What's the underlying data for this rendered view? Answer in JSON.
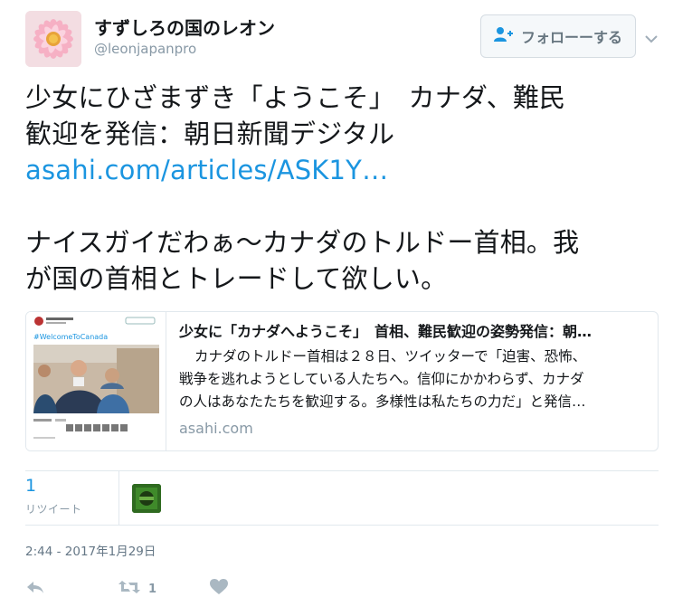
{
  "user": {
    "display_name": "すずしろの国のレオン",
    "handle": "@leonjapanpro"
  },
  "follow_button": {
    "label": "フォローーする"
  },
  "tweet": {
    "lines": [
      "少女にひざまずき「ようこそ」　カナダ、難民",
      "歓迎を発信：朝日新聞デジタル"
    ],
    "link": "asahi.com/articles/ASK1Y…",
    "comment_lines": [
      "ナイスガイだわぁ～カナダのトルドー首相。我",
      "が国の首相とトレードして欲しい。"
    ]
  },
  "card": {
    "title": "少女に「カナダへようこそ」　首相、難民歓迎の姿勢発信：朝…",
    "desc_lines": [
      "カナダのトルドー首相は２８日、ツイッターで「迫害、恐怖、",
      "戦争を逃れようとしている人たちへ。信仰にかかわらず、カナダ",
      "の人はあなたたちを歓迎する。多様性は私たちの力だ」と発信…"
    ],
    "domain": "asahi.com",
    "thumb_hashtag": "#WelcomeToCanada"
  },
  "stats": {
    "retweet_count": "1",
    "retweet_label": "リツイート"
  },
  "timestamp": "2:44 - 2017年1月29日",
  "actions": {
    "retweet_count": "1"
  },
  "colors": {
    "link": "#1b95e0",
    "muted": "#8899a6",
    "text": "#14171a",
    "border": "#e1e8ed"
  },
  "icons": [
    "follow-user-plus-icon",
    "chevron-down-icon",
    "reply-icon",
    "retweet-icon",
    "heart-icon"
  ]
}
